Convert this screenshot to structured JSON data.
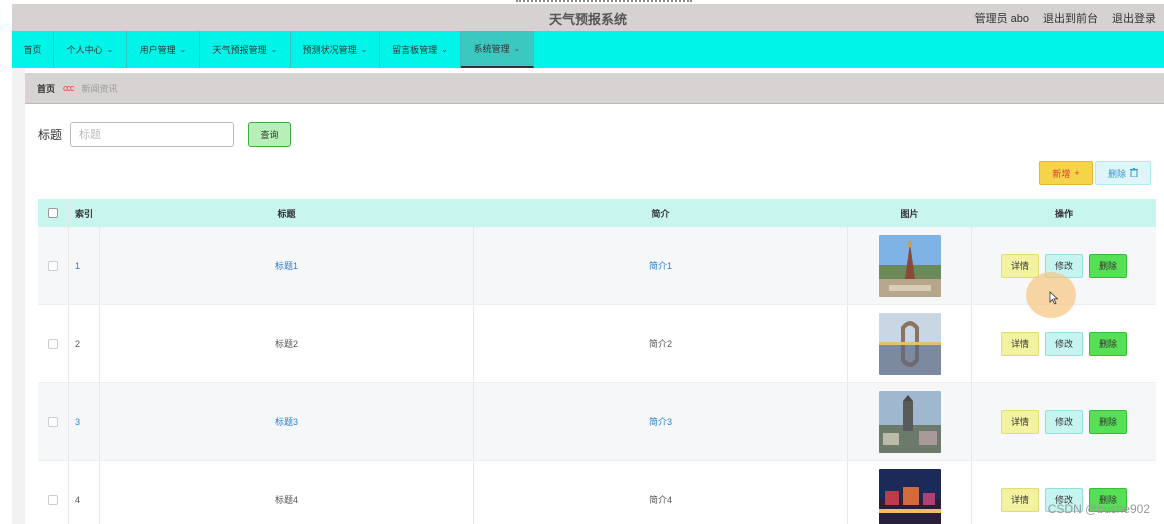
{
  "app": {
    "title": "天气预报系统",
    "top_links": [
      "管理员 abo",
      "退出到前台",
      "退出登录"
    ]
  },
  "nav": {
    "items": [
      {
        "label": "首页",
        "has_dropdown": false,
        "active": false
      },
      {
        "label": "个人中心",
        "has_dropdown": true,
        "active": false
      },
      {
        "label": "用户管理",
        "has_dropdown": true,
        "active": false
      },
      {
        "label": "天气预报管理",
        "has_dropdown": true,
        "active": false
      },
      {
        "label": "预测状况管理",
        "has_dropdown": true,
        "active": false
      },
      {
        "label": "留言板管理",
        "has_dropdown": true,
        "active": false
      },
      {
        "label": "系统管理",
        "has_dropdown": true,
        "active": true
      }
    ],
    "chevron": "⌄"
  },
  "breadcrumb": {
    "home": "首页",
    "separator": "ccc",
    "current": "新闻资讯"
  },
  "search": {
    "label": "标题",
    "placeholder": "标题",
    "value": "",
    "query_button": "查询"
  },
  "actions": {
    "add_label": "新增",
    "add_icon": "+",
    "delete_label": "删除",
    "delete_icon": "🗑"
  },
  "table": {
    "headers": {
      "index": "索引",
      "title": "标题",
      "intro": "简介",
      "image": "图片",
      "ops": "操作"
    },
    "rows": [
      {
        "index": "1",
        "title": "标题1",
        "intro": "简介1",
        "linked": true,
        "image": "pagoda-photo"
      },
      {
        "index": "2",
        "title": "标题2",
        "intro": "简介2",
        "linked": false,
        "image": "arch-reflection-photo"
      },
      {
        "index": "3",
        "title": "标题3",
        "intro": "简介3",
        "linked": true,
        "image": "city-monument-photo"
      },
      {
        "index": "4",
        "title": "标题4",
        "intro": "简介4",
        "linked": false,
        "image": "night-town-photo"
      }
    ],
    "row_ops": {
      "detail": "详情",
      "edit": "修改",
      "delete": "删除"
    }
  },
  "watermark": "CSDN @bushe902",
  "colors": {
    "nav_bg": "#00f5e8",
    "header_bg": "#d6d2d2",
    "table_head_bg": "#c9f5ef",
    "link": "#2a7fd0",
    "btn_add": "#f6d44a",
    "btn_delete_row": "#55e055"
  }
}
